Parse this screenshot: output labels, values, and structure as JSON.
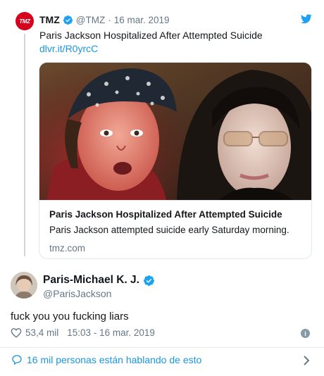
{
  "quoted_tweet": {
    "avatar_logo": "TMZ",
    "display_name": "TMZ",
    "handle": "@TMZ",
    "separator": "·",
    "date": "16 mar. 2019",
    "text": "Paris Jackson Hospitalized After Attempted Suicide",
    "link": "dlvr.it/R0yrcC",
    "card": {
      "title": "Paris Jackson Hospitalized After Attempted Suicide",
      "description": "Paris Jackson attempted suicide early Saturday morning.",
      "domain": "tmz.com"
    }
  },
  "tweet": {
    "display_name": "Paris-Michael K. J.",
    "handle": "@ParisJackson",
    "text": "fuck you you fucking liars",
    "likes": "53,4 mil",
    "timestamp": "15:03 - 16 mar. 2019",
    "info_glyph": "i"
  },
  "conversation": {
    "label": "16 mil personas están hablando de esto"
  },
  "icons": {
    "verified": "verified-badge-icon",
    "bird": "twitter-bird-icon",
    "heart": "heart-icon",
    "info": "info-icon",
    "bubble": "reply-bubble-icon",
    "chevron": "chevron-right-icon"
  },
  "colors": {
    "link_blue": "#1b95e0",
    "secondary_text": "#657786",
    "tmz_red": "#d6001c",
    "verified_blue": "#1da1f2"
  }
}
